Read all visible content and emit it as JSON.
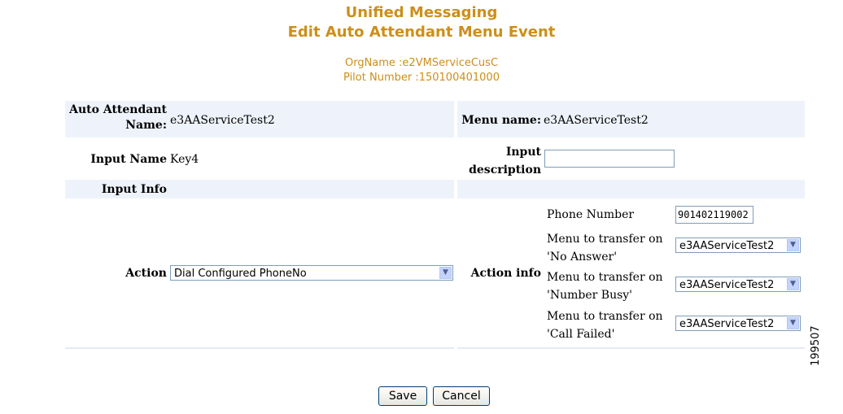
{
  "header": {
    "title": "Unified Messaging",
    "subtitle": "Edit Auto Attendant Menu Event",
    "org_name": "OrgName :e2VMServiceCusC",
    "pilot_number": "Pilot Number :150100401000"
  },
  "form": {
    "auto_attendant_label_line1": "Auto Attendant",
    "auto_attendant_label_line2": "Name:",
    "auto_attendant_value": "e3AAServiceTest2",
    "menu_name_label": "Menu name:",
    "menu_name_value": "e3AAServiceTest2",
    "input_name_label": "Input Name",
    "input_name_value": "Key4",
    "input_description_label_line1": "Input",
    "input_description_label_line2": "description",
    "input_description_value": "",
    "input_info_label": "Input Info",
    "action_label": "Action",
    "action_selected": "Dial Configured PhoneNo",
    "action_info_label": "Action info",
    "phone_number_label": "Phone Number",
    "phone_number_value": "901402119002",
    "no_answer_label_line1": "Menu to transfer on",
    "no_answer_label_line2": "'No Answer'",
    "no_answer_selected": "e3AAServiceTest2",
    "number_busy_label_line1": "Menu to transfer on",
    "number_busy_label_line2": "'Number Busy'",
    "number_busy_selected": "e3AAServiceTest2",
    "call_failed_label_line1": "Menu to transfer on",
    "call_failed_label_line2": "'Call Failed'",
    "call_failed_selected": "e3AAServiceTest2"
  },
  "buttons": {
    "save": "Save",
    "cancel": "Cancel"
  },
  "watermark": "199507",
  "colors": {
    "header_text": "#cc8f1a",
    "row_band": "#eef3fb",
    "input_border": "#7f9db9"
  }
}
